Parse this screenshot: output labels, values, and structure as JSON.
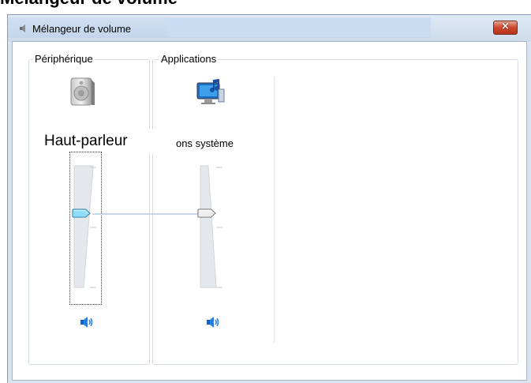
{
  "banner": {
    "text": "Mélangeur de volume"
  },
  "window": {
    "title": "Mélangeur de volume",
    "close_label": "×"
  },
  "devices_group": {
    "label": "Périphérique",
    "device": {
      "name": "Haut-parleur",
      "icon": "speaker-device-icon",
      "volume_percent": 50,
      "mute_icon": "speaker-volume-icon"
    }
  },
  "applications_group": {
    "label": "Applications",
    "app": {
      "name": "ons système",
      "icon": "system-sounds-icon",
      "volume_percent": 50,
      "mute_icon": "speaker-volume-icon"
    }
  },
  "colors": {
    "titlebar": "#d9e4f1",
    "close_button": "#c9462c",
    "thumb_active": "#6fc7ee",
    "thumb_inactive": "#e6e6e6"
  }
}
